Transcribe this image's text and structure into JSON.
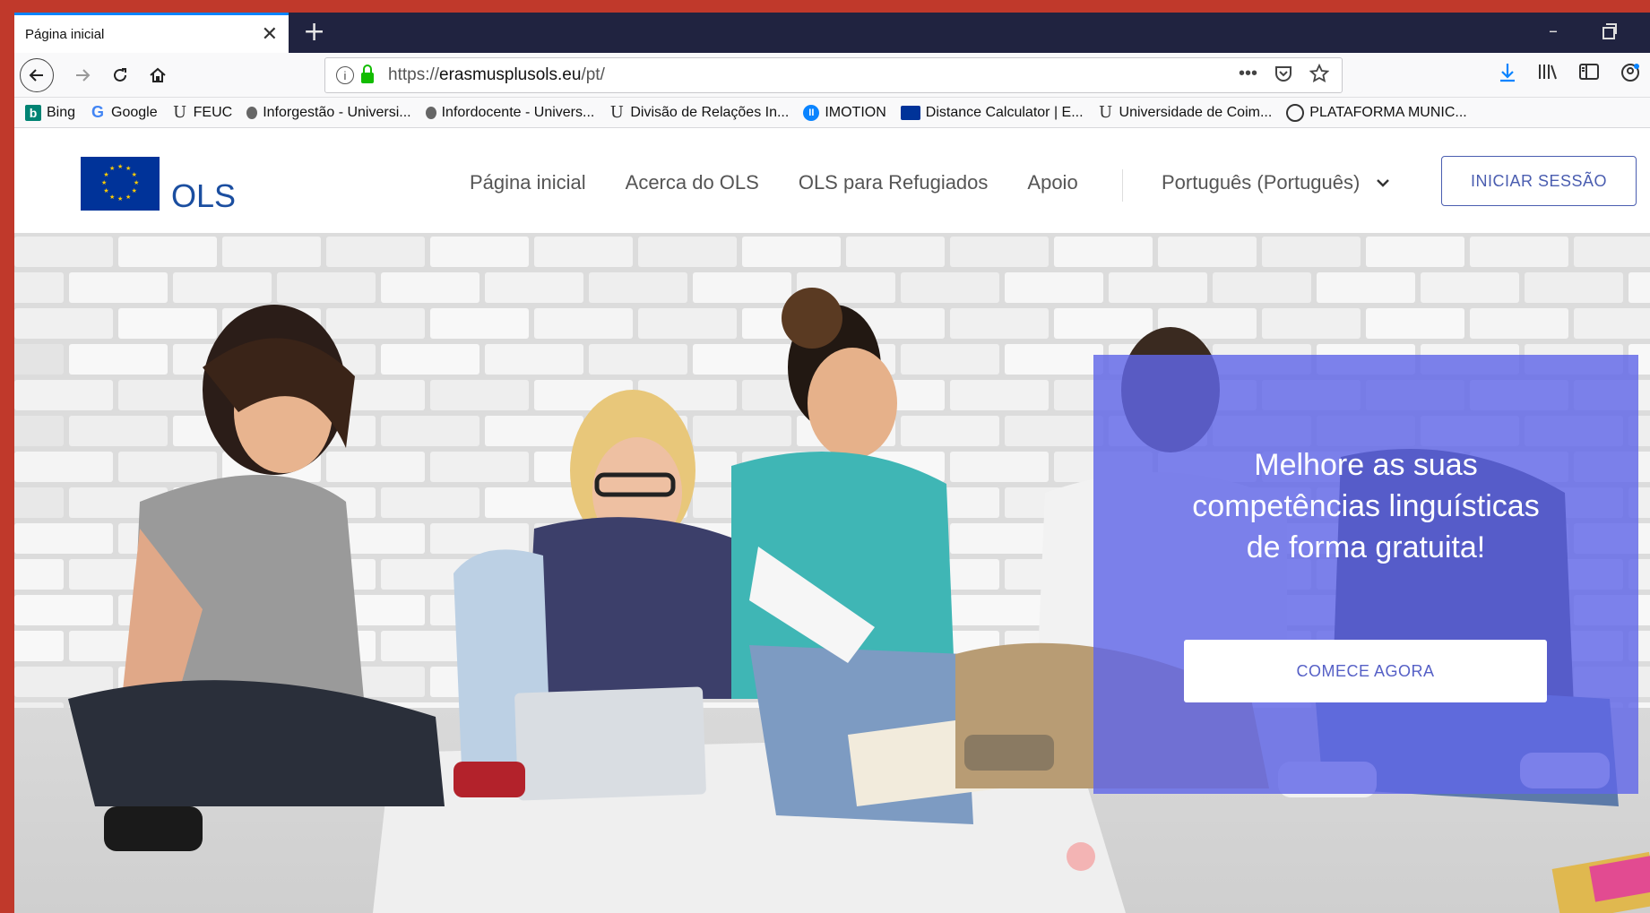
{
  "browser": {
    "tab_title": "Página inicial",
    "tab_close": "✕",
    "new_tab": "+",
    "url_scheme": "https://",
    "url_domain": "erasmusplusols.eu",
    "url_path": "/pt/",
    "url_more": "•••",
    "window_min": "–"
  },
  "bookmarks": [
    {
      "label": "Bing",
      "icon": "bing-icon"
    },
    {
      "label": "Google",
      "icon": "google-icon"
    },
    {
      "label": "FEUC",
      "icon": "uc-icon"
    },
    {
      "label": "Inforgestão - Universi...",
      "icon": "lock-icon"
    },
    {
      "label": "Infordocente - Univers...",
      "icon": "lock-icon"
    },
    {
      "label": "Divisão de Relações In...",
      "icon": "uc-icon"
    },
    {
      "label": "IMOTION",
      "icon": "imotion-icon"
    },
    {
      "label": "Distance Calculator | E...",
      "icon": "eu-flag-icon"
    },
    {
      "label": "Universidade de Coim...",
      "icon": "uc-icon"
    },
    {
      "label": "PLATAFORMA MUNIC...",
      "icon": "globe-icon"
    }
  ],
  "site": {
    "logo_text": "OLS",
    "nav": [
      "Página inicial",
      "Acerca do OLS",
      "OLS para Refugiados",
      "Apoio"
    ],
    "language": "Português (Português)",
    "login_label": "INICIAR SESSÃO"
  },
  "hero": {
    "title": "Melhore as suas competências linguísticas de forma gratuita!",
    "cta_label": "COMECE AGORA"
  },
  "colors": {
    "tabstrip": "#202340",
    "accent": "#4a5db0",
    "cta_panel": "#6066e8",
    "frame": "#c0392b"
  }
}
